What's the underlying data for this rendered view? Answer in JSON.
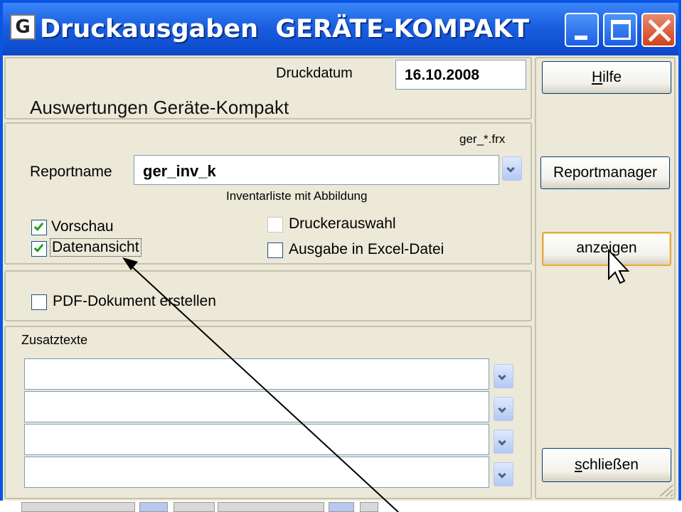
{
  "window": {
    "icon_glyph": "G",
    "title": "Druckausgaben  GERÄTE-KOMPAKT"
  },
  "header": {
    "druckdatum_label": "Druckdatum",
    "druckdatum_value": "16.10.2008",
    "subtitle": "Auswertungen Geräte-Kompakt"
  },
  "report": {
    "pattern": "ger_*.frx",
    "label": "Reportname",
    "value": "ger_inv_k",
    "description": "Inventarliste mit Abbildung"
  },
  "options": {
    "vorschau": {
      "label": "Vorschau",
      "checked": true
    },
    "datenansicht": {
      "label": "Datenansicht",
      "checked": true
    },
    "druckerauswahl": {
      "label": "Druckerauswahl",
      "checked": false,
      "enabled": false
    },
    "excel": {
      "label": "Ausgabe in Excel-Datei",
      "checked": false
    }
  },
  "pdf": {
    "label": "PDF-Dokument erstellen",
    "checked": false
  },
  "zusatz": {
    "title": "Zusatztexte",
    "rows": [
      "",
      "",
      "",
      ""
    ]
  },
  "buttons": {
    "hilfe_mnemonic": "H",
    "hilfe_rest": "ilfe",
    "reportmanager": "Reportmanager",
    "anzeigen": "anzeigen",
    "schliessen_mnemonic": "s",
    "schliessen_rest": "chließen"
  },
  "colors": {
    "titlebar": "#0a55e6",
    "face": "#ece9d8",
    "default_button_border": "#e3a74b"
  }
}
